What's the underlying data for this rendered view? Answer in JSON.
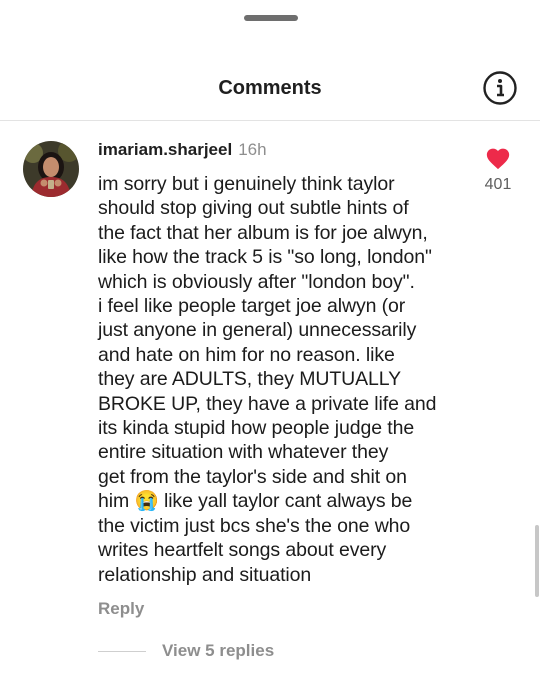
{
  "sheet": {
    "title": "Comments"
  },
  "comment": {
    "username": "imariam.sharjeel",
    "time": "16h",
    "text_part1": "im sorry but i genuinely think taylor\nshould stop giving out subtle hints of\nthe fact that her album is for joe alwyn,\nlike how the track 5 is \"so long, london\"\nwhich is obviously after \"london boy\".\ni feel like people target joe alwyn (or\njust anyone in general) unnecessarily\nand hate on him for no reason. like\nthey are ADULTS, they MUTUALLY\nBROKE UP, they have a private life and\nits kinda stupid how people judge the\nentire situation with whatever they\nget from the taylor's side and shit on\nhim ",
    "emoji": "😭",
    "text_part2": " like yall taylor cant always be\nthe victim just bcs she's the one who\nwrites heartfelt songs about every\nrelationship and situation",
    "likes": "401",
    "reply_label": "Reply",
    "view_replies": "View 5 replies"
  },
  "colors": {
    "heart": "#ed2a4a",
    "muted_text": "#8e8e8e",
    "divider": "#e3e3e3"
  },
  "icons": [
    "info-icon",
    "heart-icon",
    "avatar"
  ]
}
